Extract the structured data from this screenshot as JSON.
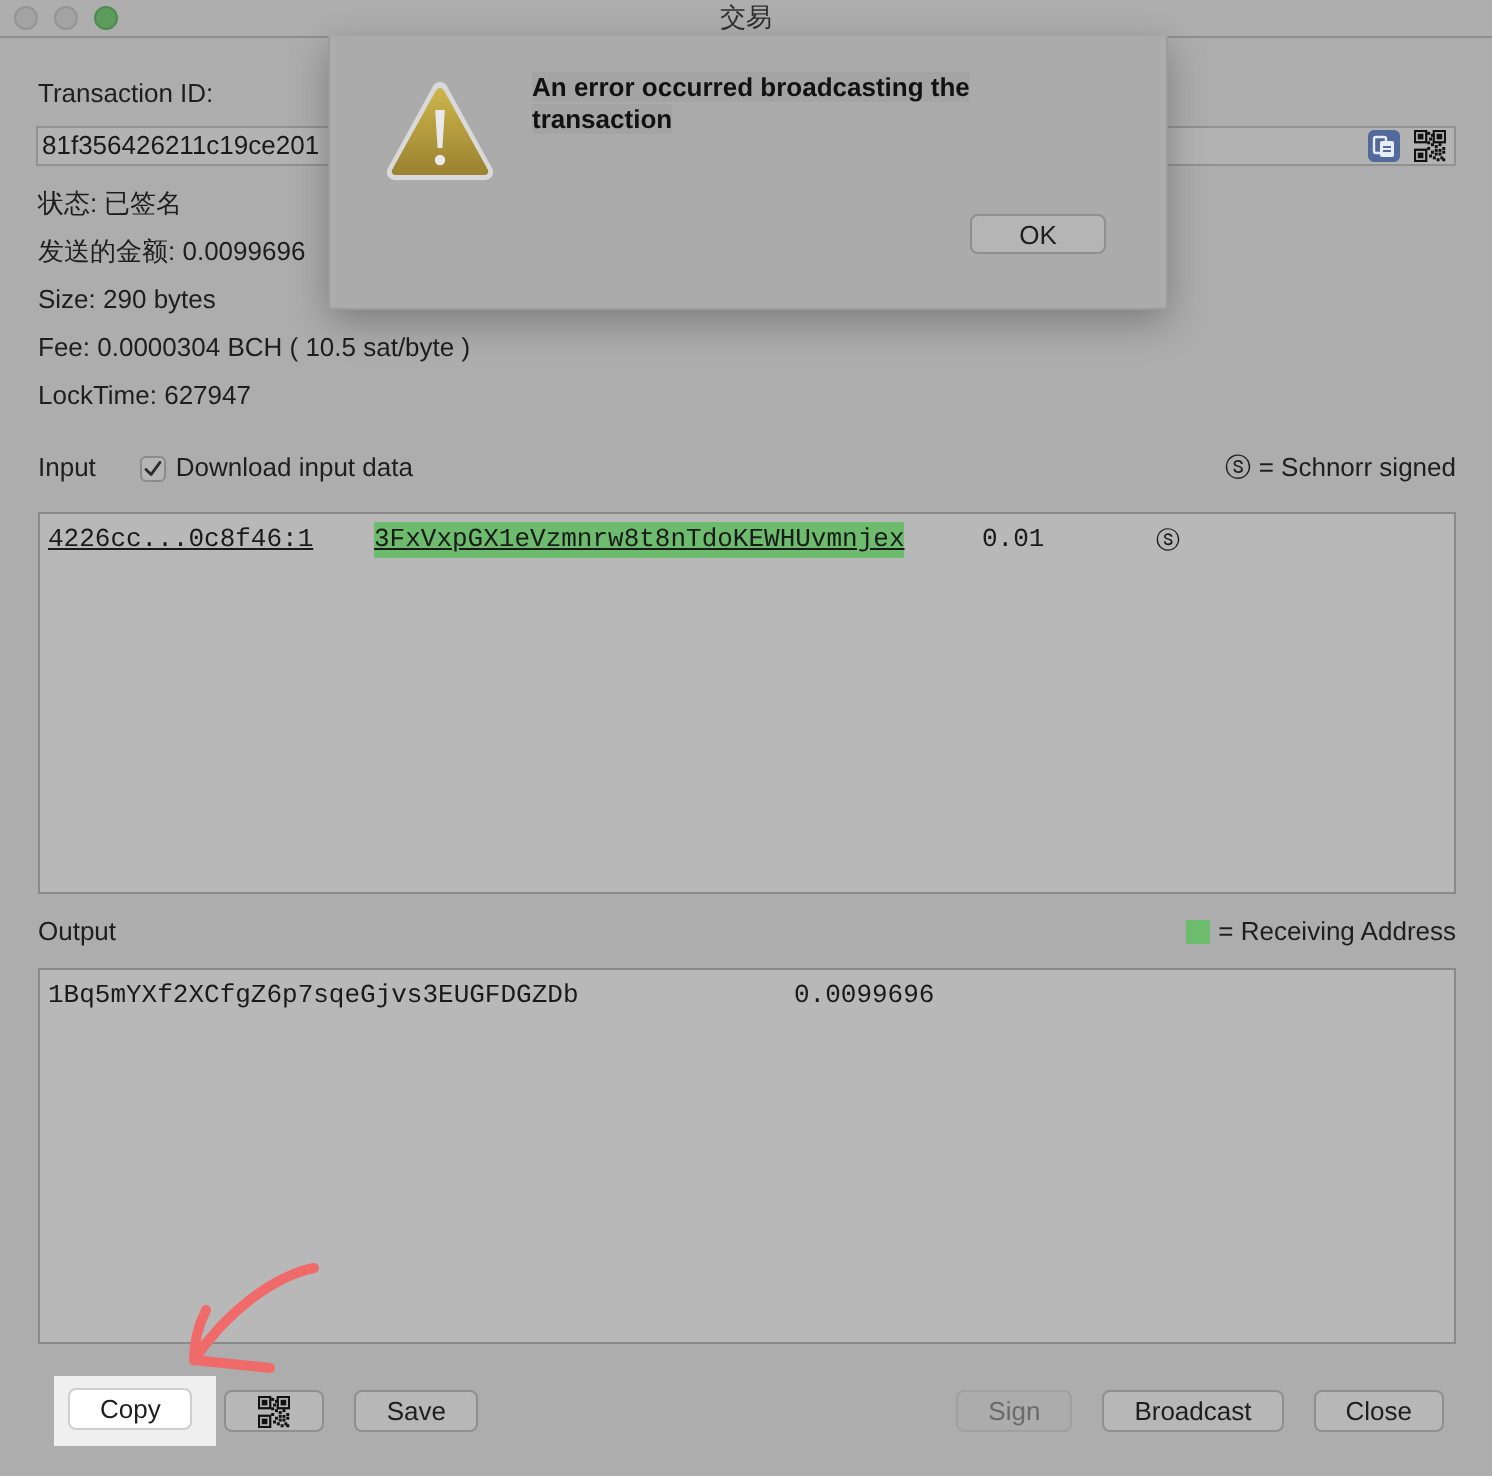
{
  "window": {
    "title": "交易"
  },
  "transaction_id": {
    "label": "Transaction ID:",
    "value": "81f356426211c19ce201"
  },
  "details": [
    "状态: 已签名",
    "发送的金额: 0.0099696",
    "Size: 290 bytes",
    "Fee: 0.0000304 BCH ( 10.5 sat/byte )",
    "LockTime: 627947"
  ],
  "input": {
    "label": "Input",
    "download_checkbox": {
      "label": "Download input data",
      "checked": true
    },
    "legend": "ⓢ = Schnorr signed",
    "rows": [
      {
        "outpoint": "4226cc...0c8f46:1",
        "address": "3FxVxpGX1eVzmnrw8t8nTdoKEWHUvmnjex",
        "receiving": true,
        "amount": "0.01",
        "signature_mark": "ⓢ"
      }
    ]
  },
  "output": {
    "label": "Output",
    "legend": "= Receiving Address",
    "rows": [
      {
        "address": "1Bq5mYXf2XCfgZ6p7sqeGjvs3EUGFDGZDb",
        "receiving": false,
        "amount": "0.0099696"
      }
    ]
  },
  "buttons": {
    "left": [
      {
        "kind": "text",
        "label": "Copy",
        "spotlight": true,
        "disabled": false
      },
      {
        "kind": "qr",
        "spotlight": false,
        "disabled": false
      },
      {
        "kind": "text",
        "label": "Save",
        "spotlight": false,
        "disabled": false
      }
    ],
    "right": [
      {
        "kind": "text",
        "label": "Sign",
        "spotlight": false,
        "disabled": true
      },
      {
        "kind": "text",
        "label": "Broadcast",
        "spotlight": false,
        "disabled": false
      },
      {
        "kind": "text",
        "label": "Close",
        "spotlight": false,
        "disabled": false
      }
    ]
  },
  "dialog": {
    "message": "An error occurred broadcasting the transaction",
    "button": "OK"
  },
  "annotation": {
    "kind": "arrow"
  }
}
